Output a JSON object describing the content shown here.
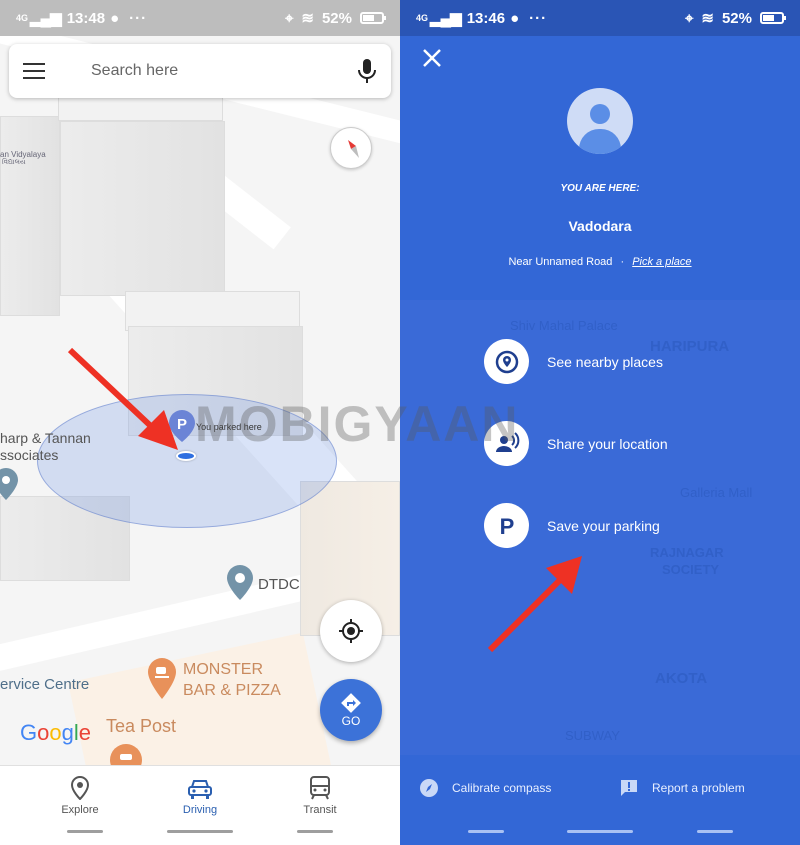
{
  "left": {
    "status": {
      "network": "4G",
      "time": "13:48",
      "more": "···",
      "battery": "52%"
    },
    "search": {
      "placeholder": "Search here"
    },
    "map_labels": {
      "school": "an Vidyalaya",
      "school_sub": "વિદ્યાલય",
      "parked": "You parked here",
      "associates_1": "harp & Tannan",
      "associates_2": "ssociates",
      "dtdc": "DTDC",
      "service": "ervice Centre",
      "monster_1": "MONSTER",
      "monster_2": "BAR & PIZZA",
      "teapost": "Tea Post",
      "parking_letter": "P"
    },
    "go_label": "GO",
    "nav": [
      {
        "label": "Explore",
        "icon": "pin-icon",
        "active": false
      },
      {
        "label": "Driving",
        "icon": "car-icon",
        "active": true
      },
      {
        "label": "Transit",
        "icon": "train-icon",
        "active": false
      }
    ],
    "google_logo": [
      "G",
      "o",
      "o",
      "g",
      "l",
      "e"
    ]
  },
  "right": {
    "status": {
      "network": "4G",
      "time": "13:46",
      "more": "···",
      "battery": "52%"
    },
    "you_are_here": "YOU ARE HERE:",
    "city": "Vadodara",
    "near": "Near Unnamed Road",
    "separator": "·",
    "pick_place": "Pick a place",
    "actions": [
      {
        "label": "See nearby places",
        "icon": "nearby-pin-icon"
      },
      {
        "label": "Share your location",
        "icon": "share-location-icon"
      },
      {
        "label": "Save your parking",
        "icon": "parking-icon"
      }
    ],
    "map_labels": [
      "HARIPURA",
      "RAJNAGAR",
      "SOCIETY",
      "AKOTA",
      "Galleria Mall",
      "SUBWAY",
      "Shiv Mahal Palace"
    ],
    "footer": [
      {
        "label": "Calibrate compass",
        "icon": "compass-icon"
      },
      {
        "label": "Report a problem",
        "icon": "report-icon"
      }
    ]
  },
  "watermark": "MOBIGYAAN",
  "colors": {
    "accent_blue": "#3367d6",
    "annotation_red": "#ee3124",
    "active_nav": "#2a5fb0"
  }
}
